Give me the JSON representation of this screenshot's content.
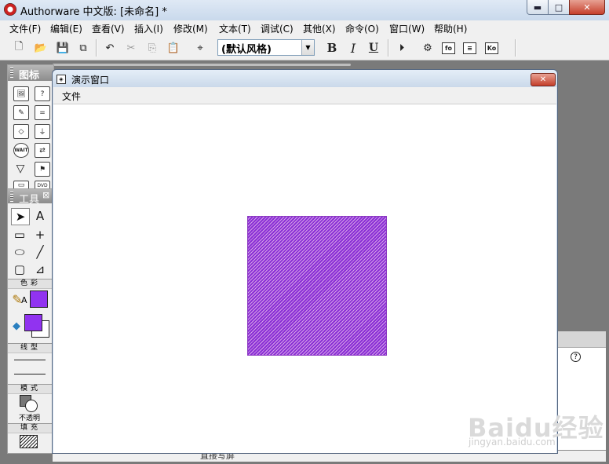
{
  "app": {
    "title": "Authorware 中文版: [未命名] *",
    "minimize_glyph": "▬",
    "maximize_glyph": "□",
    "close_glyph": "✕"
  },
  "menu": {
    "items": [
      "文件(F)",
      "编辑(E)",
      "查看(V)",
      "插入(I)",
      "修改(M)",
      "文本(T)",
      "调试(C)",
      "其他(X)",
      "命令(O)",
      "窗口(W)",
      "帮助(H)"
    ]
  },
  "toolbar": {
    "new_glyph": "🗋",
    "open_glyph": "📂",
    "save_glyph": "💾",
    "import_glyph": "⧉",
    "undo_glyph": "↶",
    "cut_glyph": "✂",
    "copy_glyph": "⎘",
    "paste_glyph": "📋",
    "find_glyph": "⌖",
    "style_value": "(默认风格)",
    "style_arrow": "▼",
    "bold_label": "B",
    "italic_label": "I",
    "underline_label": "U",
    "restart_glyph": "⏵",
    "control_glyph": "⚙",
    "functions_label": "fo",
    "variables_label": "≡",
    "knowledge_label": "Ko"
  },
  "icons_panel": {
    "title": "图标",
    "cells": [
      "🖼",
      "?",
      "✎",
      "=",
      "◇",
      "⏚",
      "WAIT",
      "⇄",
      "▽",
      "⚑",
      "▭",
      "DVD"
    ]
  },
  "tools_panel": {
    "title": "工具",
    "close_glyph": "⊠",
    "pointer_glyph": "➤",
    "text_glyph": "A",
    "rect_glyph": "▭",
    "cross_glyph": "+",
    "ellipse_glyph": "⬭",
    "line_glyph": "╱",
    "roundrect_glyph": "▢",
    "polygon_glyph": "⊿",
    "color_label": "色彩",
    "pen_glyph": "✎",
    "pen_a_label": "A",
    "fill_glyph": "◆",
    "linetype_label": "线型",
    "mode_label": "模式",
    "mode_value": "不透明",
    "fill_label": "填充",
    "swatch_color": "#9133f0"
  },
  "presentation_window": {
    "title": "演示窗口",
    "close_glyph": "✕",
    "menu_file": "文件",
    "rect_color": "#a050d4"
  },
  "background": {
    "help_glyph": "?",
    "strip_text": "直接写屏"
  },
  "watermark": {
    "text": "Baidu经验",
    "sub": "jingyan.baidu.com"
  }
}
